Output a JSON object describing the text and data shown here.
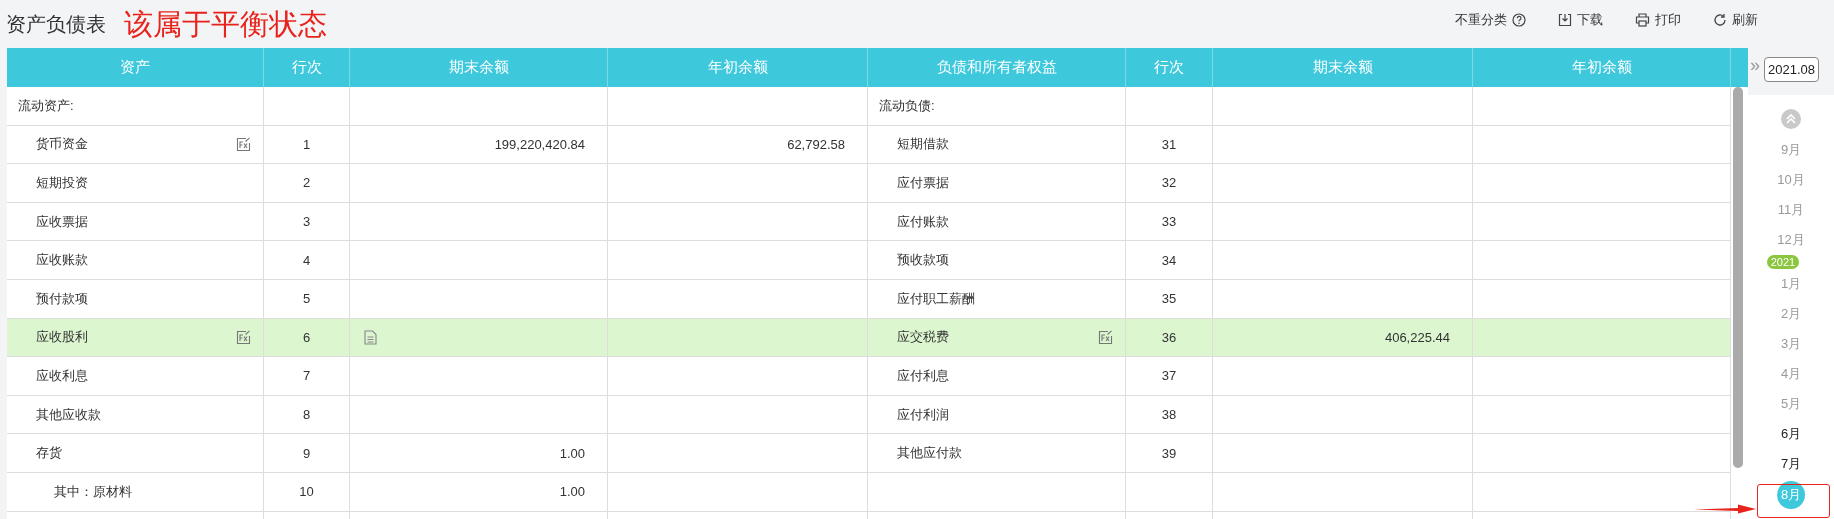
{
  "title": "资产负债表",
  "annotation": {
    "text": "该属于平衡状态",
    "arrow": true,
    "box": true
  },
  "toolbar": [
    {
      "kind": "help",
      "label": "不重分类"
    },
    {
      "kind": "download",
      "label": "下载"
    },
    {
      "kind": "print",
      "label": "打印"
    },
    {
      "kind": "refresh",
      "label": "刷新"
    }
  ],
  "table": {
    "columns": [
      "资产",
      "行次",
      "期末余额",
      "年初余额",
      "负债和所有者权益",
      "行次",
      "期末余额",
      "年初余额"
    ],
    "rows": [
      {
        "selected": false,
        "left": {
          "kind": "section",
          "name": "流动资产:",
          "formula": false,
          "note": false
        },
        "right": {
          "kind": "section",
          "name": "流动负债:",
          "formula": false,
          "note": false
        }
      },
      {
        "selected": false,
        "left": {
          "kind": "item",
          "name": "货币资金",
          "formula": true,
          "note": false,
          "line": "1",
          "end": "199,220,420.84",
          "start": "62,792.58"
        },
        "right": {
          "kind": "item",
          "name": "短期借款",
          "formula": false,
          "note": false,
          "line": "31"
        }
      },
      {
        "selected": false,
        "left": {
          "kind": "item",
          "name": "短期投资",
          "formula": false,
          "note": false,
          "line": "2"
        },
        "right": {
          "kind": "item",
          "name": "应付票据",
          "formula": false,
          "note": false,
          "line": "32"
        }
      },
      {
        "selected": false,
        "left": {
          "kind": "item",
          "name": "应收票据",
          "formula": false,
          "note": false,
          "line": "3"
        },
        "right": {
          "kind": "item",
          "name": "应付账款",
          "formula": false,
          "note": false,
          "line": "33"
        }
      },
      {
        "selected": false,
        "left": {
          "kind": "item",
          "name": "应收账款",
          "formula": false,
          "note": false,
          "line": "4"
        },
        "right": {
          "kind": "item",
          "name": "预收款项",
          "formula": false,
          "note": false,
          "line": "34"
        }
      },
      {
        "selected": false,
        "left": {
          "kind": "item",
          "name": "预付款项",
          "formula": false,
          "note": false,
          "line": "5"
        },
        "right": {
          "kind": "item",
          "name": "应付职工薪酬",
          "formula": false,
          "note": false,
          "line": "35"
        }
      },
      {
        "selected": true,
        "left": {
          "kind": "item",
          "name": "应收股利",
          "formula": true,
          "note": true,
          "line": "6"
        },
        "right": {
          "kind": "item",
          "name": "应交税费",
          "formula": true,
          "note": false,
          "line": "36",
          "end": "406,225.44"
        }
      },
      {
        "selected": false,
        "left": {
          "kind": "item",
          "name": "应收利息",
          "formula": false,
          "note": false,
          "line": "7"
        },
        "right": {
          "kind": "item",
          "name": "应付利息",
          "formula": false,
          "note": false,
          "line": "37"
        }
      },
      {
        "selected": false,
        "left": {
          "kind": "item",
          "name": "其他应收款",
          "formula": false,
          "note": false,
          "line": "8"
        },
        "right": {
          "kind": "item",
          "name": "应付利润",
          "formula": false,
          "note": false,
          "line": "38"
        }
      },
      {
        "selected": false,
        "left": {
          "kind": "item",
          "name": "存货",
          "formula": false,
          "note": false,
          "line": "9",
          "end": "1.00"
        },
        "right": {
          "kind": "item",
          "name": "其他应付款",
          "formula": false,
          "note": false,
          "line": "39"
        }
      },
      {
        "selected": false,
        "left": {
          "kind": "sub",
          "name": "其中：原材料",
          "formula": false,
          "note": false,
          "line": "10",
          "end": "1.00"
        },
        "right": {
          "kind": "empty"
        }
      }
    ]
  },
  "period": {
    "toggle": "»",
    "value": "2021.08",
    "months": [
      {
        "kind": "month",
        "label": "9月",
        "dim": true,
        "selected": false
      },
      {
        "kind": "month",
        "label": "10月",
        "dim": true,
        "selected": false
      },
      {
        "kind": "month",
        "label": "11月",
        "dim": true,
        "selected": false
      },
      {
        "kind": "month",
        "label": "12月",
        "dim": true,
        "selected": false
      },
      {
        "kind": "year",
        "label": "2021"
      },
      {
        "kind": "month",
        "label": "1月",
        "dim": true,
        "selected": false
      },
      {
        "kind": "month",
        "label": "2月",
        "dim": true,
        "selected": false
      },
      {
        "kind": "month",
        "label": "3月",
        "dim": true,
        "selected": false
      },
      {
        "kind": "month",
        "label": "4月",
        "dim": true,
        "selected": false
      },
      {
        "kind": "month",
        "label": "5月",
        "dim": true,
        "selected": false
      },
      {
        "kind": "month",
        "label": "6月",
        "dim": false,
        "selected": false
      },
      {
        "kind": "month",
        "label": "7月",
        "dim": false,
        "selected": false
      },
      {
        "kind": "month",
        "label": "8月",
        "dim": false,
        "selected": true
      }
    ]
  }
}
